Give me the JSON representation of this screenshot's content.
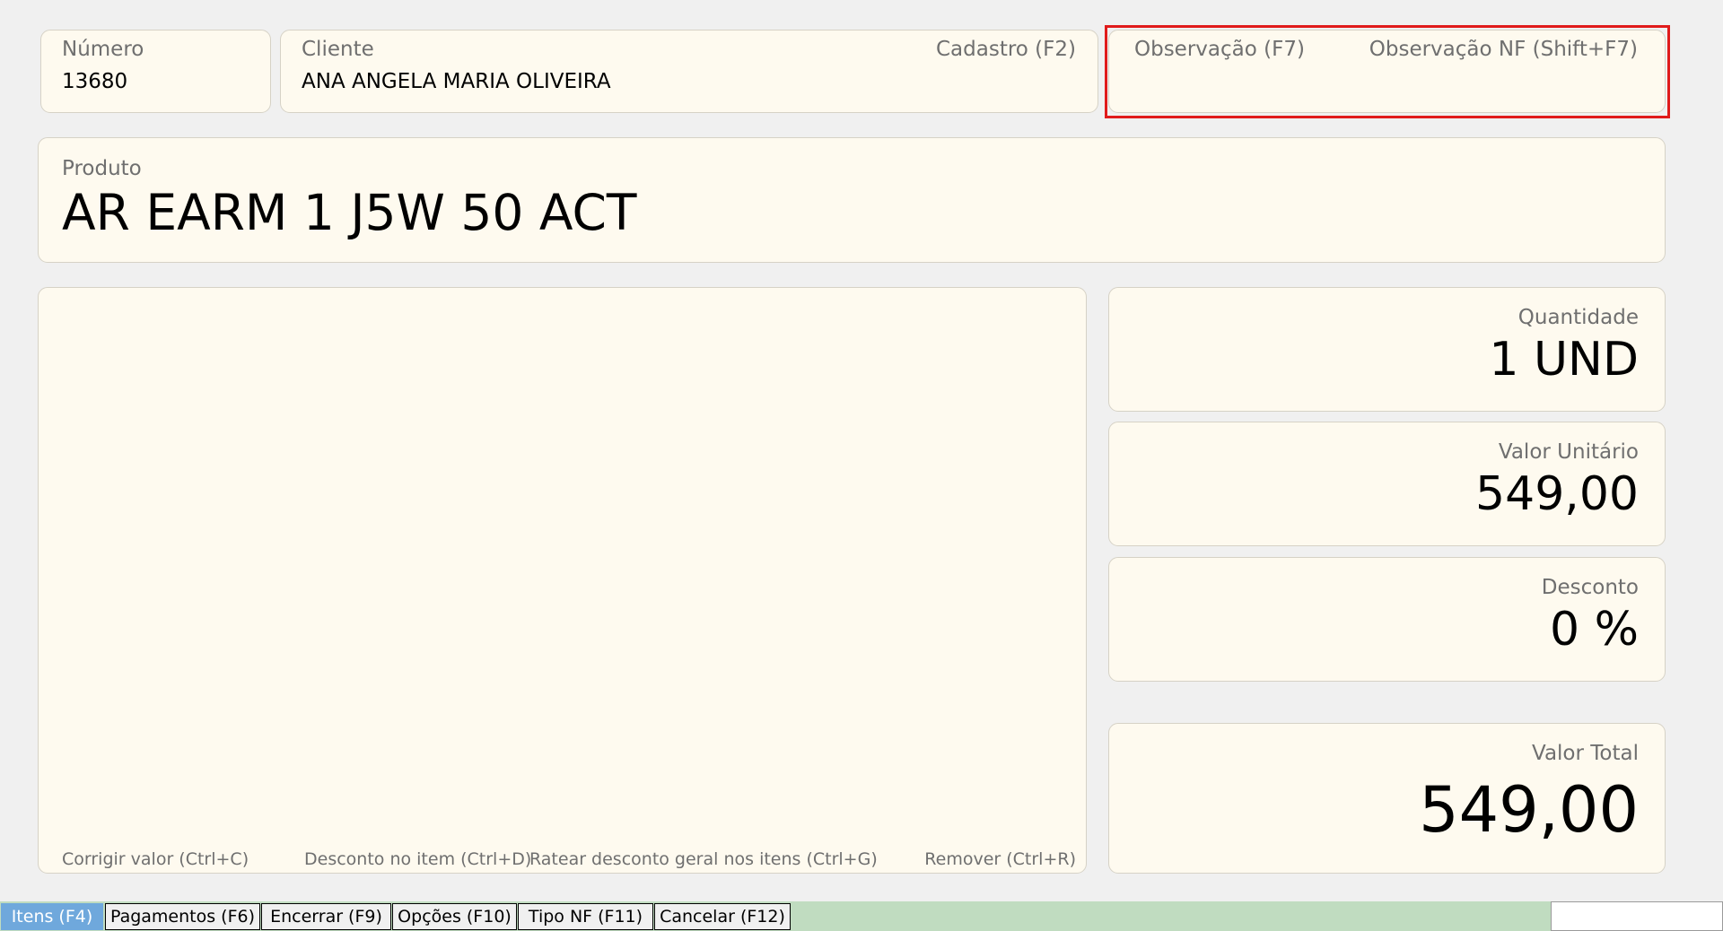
{
  "header": {
    "numero": {
      "label": "Número",
      "value": "13680"
    },
    "cliente": {
      "label": "Cliente",
      "value": "ANA ANGELA MARIA OLIVEIRA",
      "cadastro_link": "Cadastro (F2)"
    },
    "observacao": {
      "label": "Observação (F7)",
      "nf_link": "Observação NF (Shift+F7)"
    }
  },
  "produto": {
    "label": "Produto",
    "value": "AR EARM 1 J5W 50 ACT"
  },
  "items_panel": {
    "hints": {
      "corrigir": "Corrigir valor (Ctrl+C)",
      "desconto_item": "Desconto no item (Ctrl+D)",
      "ratear": "Ratear desconto geral nos itens (Ctrl+G)",
      "remover": "Remover (Ctrl+R)"
    }
  },
  "summary": {
    "quantidade": {
      "label": "Quantidade",
      "value": "1 UND"
    },
    "valor_unitario": {
      "label": "Valor Unitário",
      "value": "549,00"
    },
    "desconto": {
      "label": "Desconto",
      "value": "0 %"
    },
    "valor_total": {
      "label": "Valor Total",
      "value": "549,00"
    }
  },
  "tabs": [
    {
      "label": "Itens (F4)",
      "active": true
    },
    {
      "label": "Pagamentos (F6)"
    },
    {
      "label": "Encerrar (F9)"
    },
    {
      "label": "Opções (F10)"
    },
    {
      "label": "Tipo NF (F11)"
    },
    {
      "label": "Cancelar (F12)"
    }
  ],
  "colors": {
    "panel_bg": "#fefaef",
    "bottom_bar": "#c0dcc0",
    "active_tab": "#6fa8dc",
    "highlight": "#e01b1b"
  }
}
